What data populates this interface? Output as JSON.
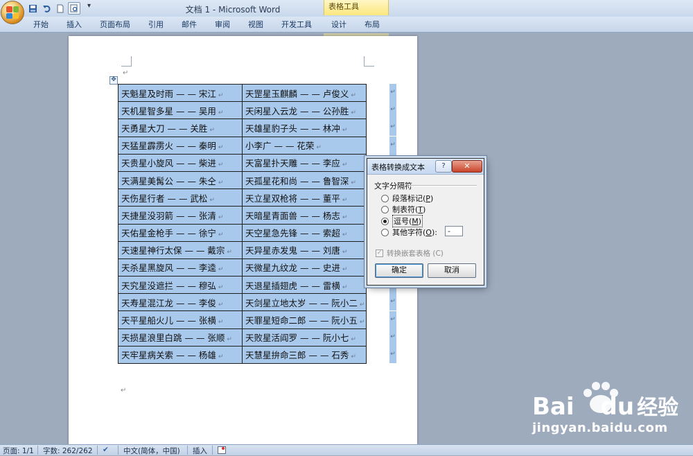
{
  "window": {
    "title": "文档 1 - Microsoft Word",
    "context_group": "表格工具"
  },
  "ribbon": {
    "tabs": [
      "开始",
      "插入",
      "页面布局",
      "引用",
      "邮件",
      "审阅",
      "视图",
      "开发工具",
      "设计",
      "布局"
    ]
  },
  "table": {
    "rows": [
      [
        "天魁星及时雨 — — 宋江",
        "天罡星玉麒麟 — — 卢俊义"
      ],
      [
        "天机星智多星 — — 吴用",
        "天闲星入云龙 — — 公孙胜"
      ],
      [
        "天勇星大刀 — — 关胜",
        "天雄星豹子头 — — 林冲"
      ],
      [
        "天猛星霹雳火 — — 秦明",
        "小李广 — — 花荣"
      ],
      [
        "天贵星小旋风 — — 柴进",
        "天富星扑天雕 — — 李应"
      ],
      [
        "天满星美髯公 — — 朱仝",
        "天孤星花和尚 — — 鲁智深"
      ],
      [
        "天伤星行者 — — 武松",
        "天立星双枪将 — — 董平"
      ],
      [
        "天捷星没羽箭 — — 张清",
        "天暗星青面兽 — — 杨志"
      ],
      [
        "天佑星金枪手 — — 徐宁",
        "天空星急先锋 — — 索超"
      ],
      [
        "天速星神行太保 — — 戴宗",
        "天异星赤发鬼 — — 刘唐"
      ],
      [
        "天杀星黑旋风 — — 李逵",
        "天微星九纹龙 — — 史进"
      ],
      [
        "天究星没遮拦 — — 穆弘",
        "天退星插翅虎 — — 雷横"
      ],
      [
        "天寿星混江龙 — — 李俊",
        "天剑星立地太岁 — — 阮小二"
      ],
      [
        "天平星船火儿 — — 张横",
        "天罪星短命二郎 — — 阮小五"
      ],
      [
        "天损星浪里白跳 — — 张顺",
        "天败星活阎罗 — — 阮小七"
      ],
      [
        "天牢星病关索 — — 杨雄",
        "天慧星拚命三郎 — — 石秀"
      ]
    ]
  },
  "dialog": {
    "title": "表格转换成文本",
    "help": "?",
    "close": "✕",
    "group_label": "文字分隔符",
    "options": [
      {
        "label": "段落标记",
        "key": "P",
        "checked": false
      },
      {
        "label": "制表符",
        "key": "T",
        "checked": false
      },
      {
        "label": "逗号",
        "key": "M",
        "checked": true
      },
      {
        "label": "其他字符",
        "key": "O",
        "checked": false
      }
    ],
    "other_value": "-",
    "nested_label": "转换嵌套表格",
    "nested_key": "C",
    "ok_label": "确定",
    "cancel_label": "取消"
  },
  "statusbar": {
    "page": "页面: 1/1",
    "words": "字数: 262/262",
    "language": "中文(简体，中国)",
    "mode": "插入"
  },
  "watermark": {
    "brand": "Bai",
    "brand2": "du",
    "cn": "经验",
    "url": "jingyan.baidu.com"
  }
}
